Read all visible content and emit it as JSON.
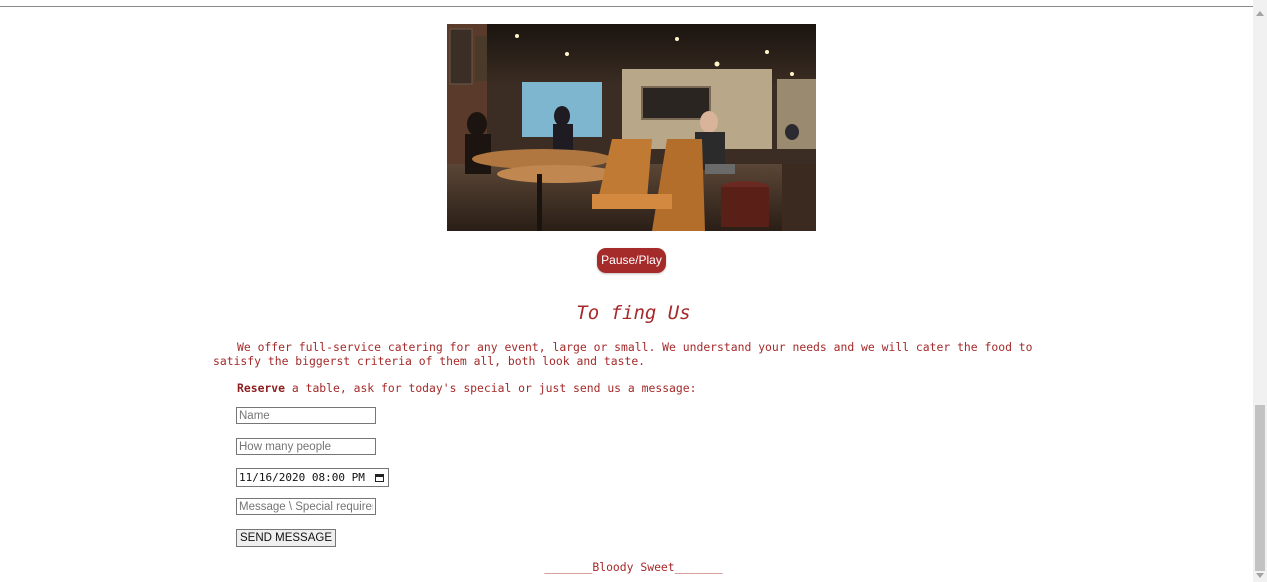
{
  "video": {
    "control_label": "Pause/Play"
  },
  "section": {
    "heading": "To fing Us",
    "intro": "We offer full-service catering for any event, large or small. We understand your needs and we will cater the food to satisfy the biggerst criteria of them all, both look and taste.",
    "reserve_bold": "Reserve",
    "reserve_rest": " a table, ask for today's special or just send us a message:"
  },
  "form": {
    "name_placeholder": "Name",
    "people_placeholder": "How many people",
    "datetime_value": "11/16/2020 08:00 PM",
    "message_placeholder": "Message \\ Special requirements",
    "send_label": "SEND MESSAGE"
  },
  "footer": {
    "text": "_______Bloody Sweet_______"
  },
  "colors": {
    "accent": "#a52a2a"
  },
  "icons": {
    "calendar": "calendar-icon"
  }
}
